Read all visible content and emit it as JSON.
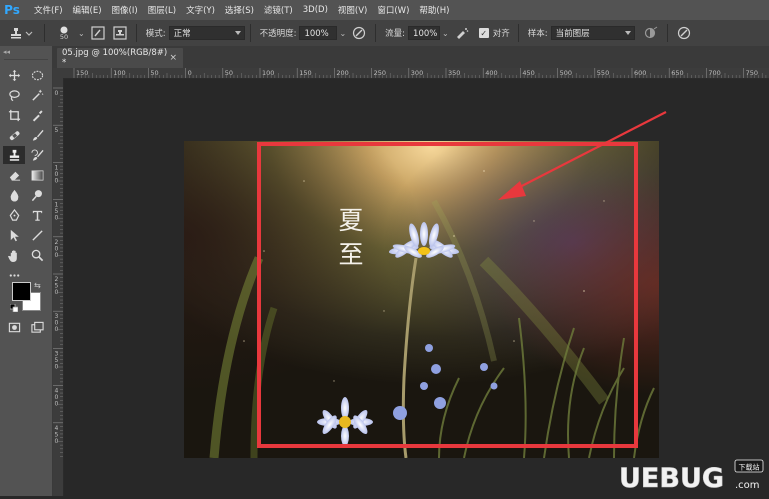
{
  "app": {
    "logo": "Ps"
  },
  "menu": {
    "items": [
      "文件(F)",
      "编辑(E)",
      "图像(I)",
      "图层(L)",
      "文字(Y)",
      "选择(S)",
      "滤镜(T)",
      "3D(D)",
      "视图(V)",
      "窗口(W)",
      "帮助(H)"
    ]
  },
  "options": {
    "brush_size": "50",
    "mode_label": "模式:",
    "mode_value": "正常",
    "opacity_label": "不透明度:",
    "opacity_value": "100%",
    "flow_label": "流量:",
    "flow_value": "100%",
    "aligned_label": "对齐",
    "aligned_checked": true,
    "sample_label": "样本:",
    "sample_value": "当前图层"
  },
  "document": {
    "tab_title": "05.jpg @ 100%(RGB/8#) *",
    "close_glyph": "×"
  },
  "rulers": {
    "horizontal": [
      "150",
      "100",
      "50",
      "0",
      "50",
      "100",
      "150",
      "200",
      "250",
      "300",
      "350",
      "400",
      "450",
      "500",
      "550",
      "600",
      "650",
      "700",
      "750"
    ],
    "vertical": [
      "0",
      "5",
      "1\n0\n0",
      "1\n5\n0",
      "2\n0\n0",
      "2\n5\n0",
      "3\n0\n0",
      "3\n5\n0",
      "4\n0\n0",
      "4\n5\n0"
    ]
  },
  "photo": {
    "calligraphy": [
      "夏",
      "至"
    ]
  },
  "watermark": {
    "brand": "UEBUG",
    "badge": "下载站",
    "domain": ".com"
  },
  "colors": {
    "highlight": "#e8383d",
    "foreground": "#000000",
    "background": "#ffffff",
    "accent": "#31a8ff"
  }
}
